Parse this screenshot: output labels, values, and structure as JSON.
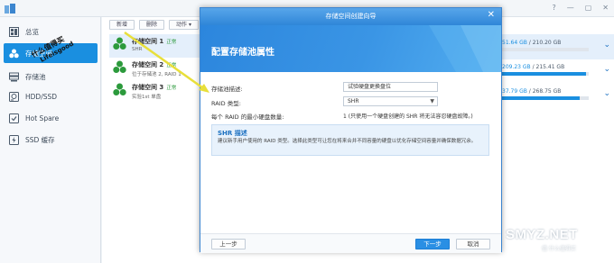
{
  "sidebar": {
    "items": [
      {
        "label": "总览",
        "icon": "dashboard-icon"
      },
      {
        "label": "存储空间",
        "icon": "storage-volume-icon",
        "active": true
      },
      {
        "label": "存储池",
        "icon": "storage-pool-icon"
      },
      {
        "label": "HDD/SSD",
        "icon": "hdd-icon"
      },
      {
        "label": "Hot Spare",
        "icon": "hot-spare-icon"
      },
      {
        "label": "SSD 缓存",
        "icon": "ssd-cache-icon"
      }
    ]
  },
  "toolbar": {
    "create_label": "新增",
    "delete_label": "删除",
    "action_label": "动作 ▾"
  },
  "volumes": [
    {
      "name": "存储空间 1",
      "status": "正常",
      "sub": "SHR"
    },
    {
      "name": "存储空间 2",
      "status": "正常",
      "sub": "位于存储池 2, RAID 1"
    },
    {
      "name": "存储空间 3",
      "status": "正常",
      "sub": "实验1st 单盘"
    }
  ],
  "usage": [
    {
      "used": "51.64 GB",
      "total": "210.20 GB",
      "fraction": 0.0
    },
    {
      "used": "209.23 GB",
      "total": "215.41 GB",
      "fraction": 0.97
    },
    {
      "used": "37.79 GB",
      "total": "268.75 GB",
      "fraction": 0.9
    }
  ],
  "dialog": {
    "window_title": "存储空间创建向导",
    "header_title": "配置存储池属性",
    "desc_label": "存储池描述:",
    "desc_value": "试验硬盘更换盘位",
    "raid_label": "RAID 类型:",
    "raid_value": "SHR",
    "min_disks_label": "每个 RAID 的最小硬盘数量:",
    "min_disks_value": "1 (只使用一个硬盘创建的 SHR 将无法容忍硬盘故障。)",
    "info_title": "SHR 描述",
    "info_text": "建议新手用户使用的 RAID 类型。选择此类型可让您在将来合并不同容量的硬盘以优化存储空间容量并确保数据冗余。",
    "back_label": "上一步",
    "next_label": "下一步",
    "cancel_label": "取消"
  },
  "watermark": {
    "line1": "什么值得买",
    "line2": "Lifeisgood"
  },
  "site_logo": {
    "text": "SMYZ.NET",
    "sub": "值 什么值得买"
  },
  "colors": {
    "accent": "#1a8fe0",
    "status_ok": "#2c9a3c",
    "arrow": "#e8df3a"
  }
}
